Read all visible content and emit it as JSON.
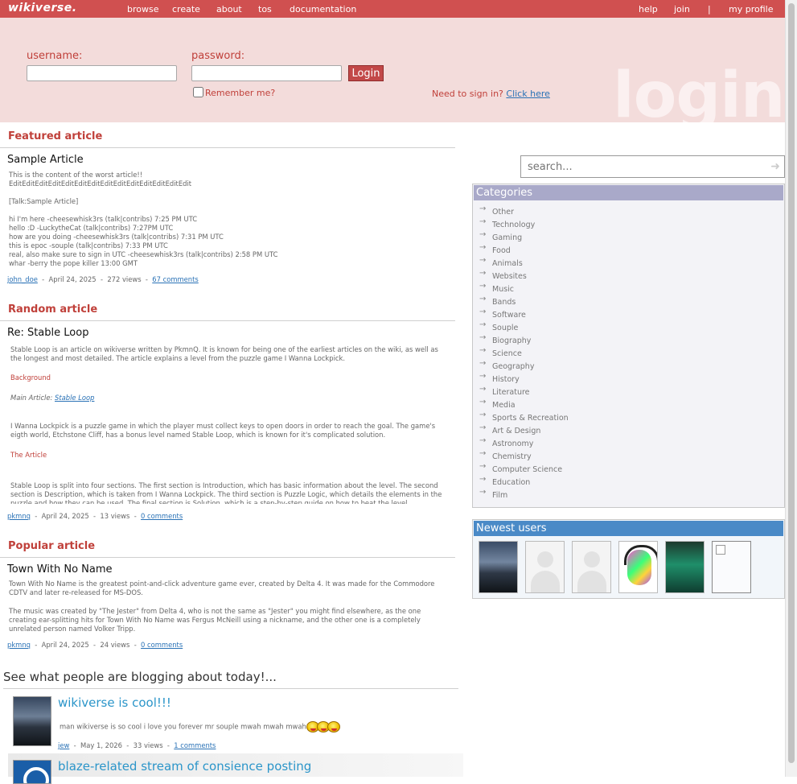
{
  "nav": {
    "logo": "wikiverse.",
    "left": [
      "browse",
      "create",
      "about",
      "tos",
      "documentation"
    ],
    "right": [
      "help",
      "join",
      "|",
      "my profile"
    ]
  },
  "login": {
    "username_label": "username:",
    "password_label": "password:",
    "login_button": "Login",
    "remember_label": "Remember me?",
    "signin_prompt": "Need to sign in?",
    "signin_link": "Click here",
    "watermark": "login"
  },
  "featured": {
    "heading": "Featured article",
    "title": "Sample Article",
    "body": [
      "This is the content of the worst article!!",
      "EditEditEditEditEditEditEditEditEditEditEditEditEditEdit",
      "",
      "[Talk:Sample Article]",
      "",
      "hi I'm here -cheesewhisk3rs (talk|contribs) 7:25 PM UTC",
      "hello :D -LuckytheCat (talk|contribs) 7:27PM UTC",
      "how are you doing -cheesewhisk3rs (talk|contribs) 7:31 PM UTC",
      "this is epoc -souple (talk|contribs) 7:33 PM UTC",
      "real, also make sure to sign in UTC -cheesewhisk3rs (talk|contribs) 2:58 PM UTC",
      "whar -berry the pope killer 13:00 GMT"
    ],
    "author": "john_doe",
    "date": "April 24, 2025",
    "views": "272 views",
    "comments": "67 comments"
  },
  "random": {
    "heading": "Random article",
    "title": "Re: Stable Loop",
    "intro": "Stable Loop is an article on wikiverse written by PkmnQ. It is known for being one of the earliest articles on the wiki, as well as the longest and most detailed. The article explains a level from the puzzle game I Wanna Lockpick.",
    "sub1": "Background",
    "main_article_prefix": "Main Article:",
    "main_article_link": "Stable Loop",
    "para2": "I Wanna Lockpick is a puzzle game in which the player must collect keys to open doors in order to reach the goal. The game's eigth world, Etchstone Cliff, has a bonus level named Stable Loop, which is known for it's complicated solution.",
    "sub2": "The Article",
    "para3": "Stable Loop is split into four sections. The first section is Introduction, which has basic information about the level. The second section is Description, which is taken from I Wanna Lockpick. The third section is Puzzle Logic, which details the elements in the puzzle and how they can be used. The final section is Solution, which is a step-by-step guide on how to beat the level.",
    "author": "pkmnq",
    "date": "April 24, 2025",
    "views": "13 views",
    "comments": "0 comments"
  },
  "popular": {
    "heading": "Popular article",
    "title": "Town With No Name",
    "para1": "Town With No Name is the greatest point-and-click adventure game ever, created by Delta 4. It was made for the Commodore CDTV and later re-released for MS-DOS.",
    "para2": "The music was created by \"The Jester\" from Delta 4, who is not the same as \"Jester\" you might find elsewhere, as the one creating ear-splitting hits for Town With No Name was Fergus McNeill using a nickname, and the other one is a completely unrelated person named Volker Tripp.",
    "author": "pkmnq",
    "date": "April 24, 2025",
    "views": "24 views",
    "comments": "0 comments"
  },
  "blogs": {
    "heading": "See what people are blogging about today!...",
    "post1": {
      "title": "wikiverse is cool!!!",
      "text": "man wikiverse is so cool i love you forever mr souple mwah mwah mwah",
      "author": "jew",
      "date": "May 1, 2026",
      "views": "33 views",
      "comments": "1 comments"
    },
    "post2": {
      "title": "blaze-related stream of consience posting"
    }
  },
  "search": {
    "placeholder": "search..."
  },
  "categories": {
    "heading": "Categories",
    "items": [
      "Other",
      "Technology",
      "Gaming",
      "Food",
      "Animals",
      "Websites",
      "Music",
      "Bands",
      "Software",
      "Souple",
      "Biography",
      "Science",
      "Geography",
      "History",
      "Literature",
      "Media",
      "Sports & Recreation",
      "Art & Design",
      "Astronomy",
      "Chemistry",
      "Computer Science",
      "Education",
      "Film"
    ]
  },
  "newest_users": {
    "heading": "Newest users"
  },
  "colors": {
    "nav_bg": "#d05050",
    "login_bg": "#f3dcdb",
    "accent_red": "#c0403a",
    "categories_head": "#a9a9c9",
    "newest_users_head": "#4a8ac7",
    "blog_title": "#2b95c9"
  }
}
